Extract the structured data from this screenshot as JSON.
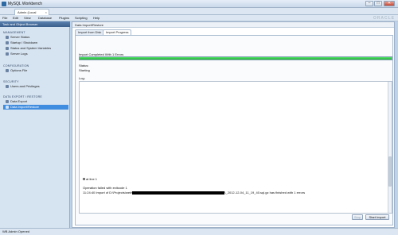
{
  "window": {
    "title": "MySQL Workbench",
    "minimize": "–",
    "maximize": "□",
    "close": "✕"
  },
  "tabs": {
    "main_tab": "Admin (Local MySQL)",
    "close": "×"
  },
  "menu": [
    "File",
    "Edit",
    "View",
    "Database",
    "Plugins",
    "Scripting",
    "Help"
  ],
  "brand": "ORACLE",
  "sidebar": {
    "title": "Task and Object Browser",
    "sections": {
      "management": "MANAGEMENT",
      "configuration": "CONFIGURATION",
      "security": "SECURITY",
      "data_export": "DATA EXPORT / RESTORE"
    },
    "items": {
      "server_status": "Server Status",
      "startup_shutdown": "Startup / Shutdown",
      "status_vars": "Status and System Variables",
      "server_logs": "Server Logs",
      "options_file": "Options File",
      "users_privileges": "Users and Privileges",
      "data_export": "Data Export",
      "data_import": "Data Import/Restore"
    }
  },
  "content": {
    "header": "Data Import/Restore",
    "subtabs": {
      "import_from_disk": "Import from Disk",
      "import_progress": "Import Progress"
    },
    "completed": "Import Completed With 1 Errors",
    "progress": 1.0,
    "status_label": "Status:",
    "status_value": "Starting",
    "log_label": "Log:",
    "log": {
      "at_line": "at line 1",
      "operation_failed": "Operation failed with exitcode 1",
      "line_prefix": "11:24:40 Import of D:\\Projects\\web\\",
      "line_suffix": "\\_2012-12-04_11_19_40.sql.gz has finished with 1 errors"
    },
    "buttons": {
      "stop": "Stop",
      "start_import": "Start Import"
    }
  },
  "statusbar": "WB Admin Opened",
  "colors": {
    "progress": "#1fb53a",
    "selection": "#3f8de0",
    "sidebar_header": "#3b5f8c"
  }
}
